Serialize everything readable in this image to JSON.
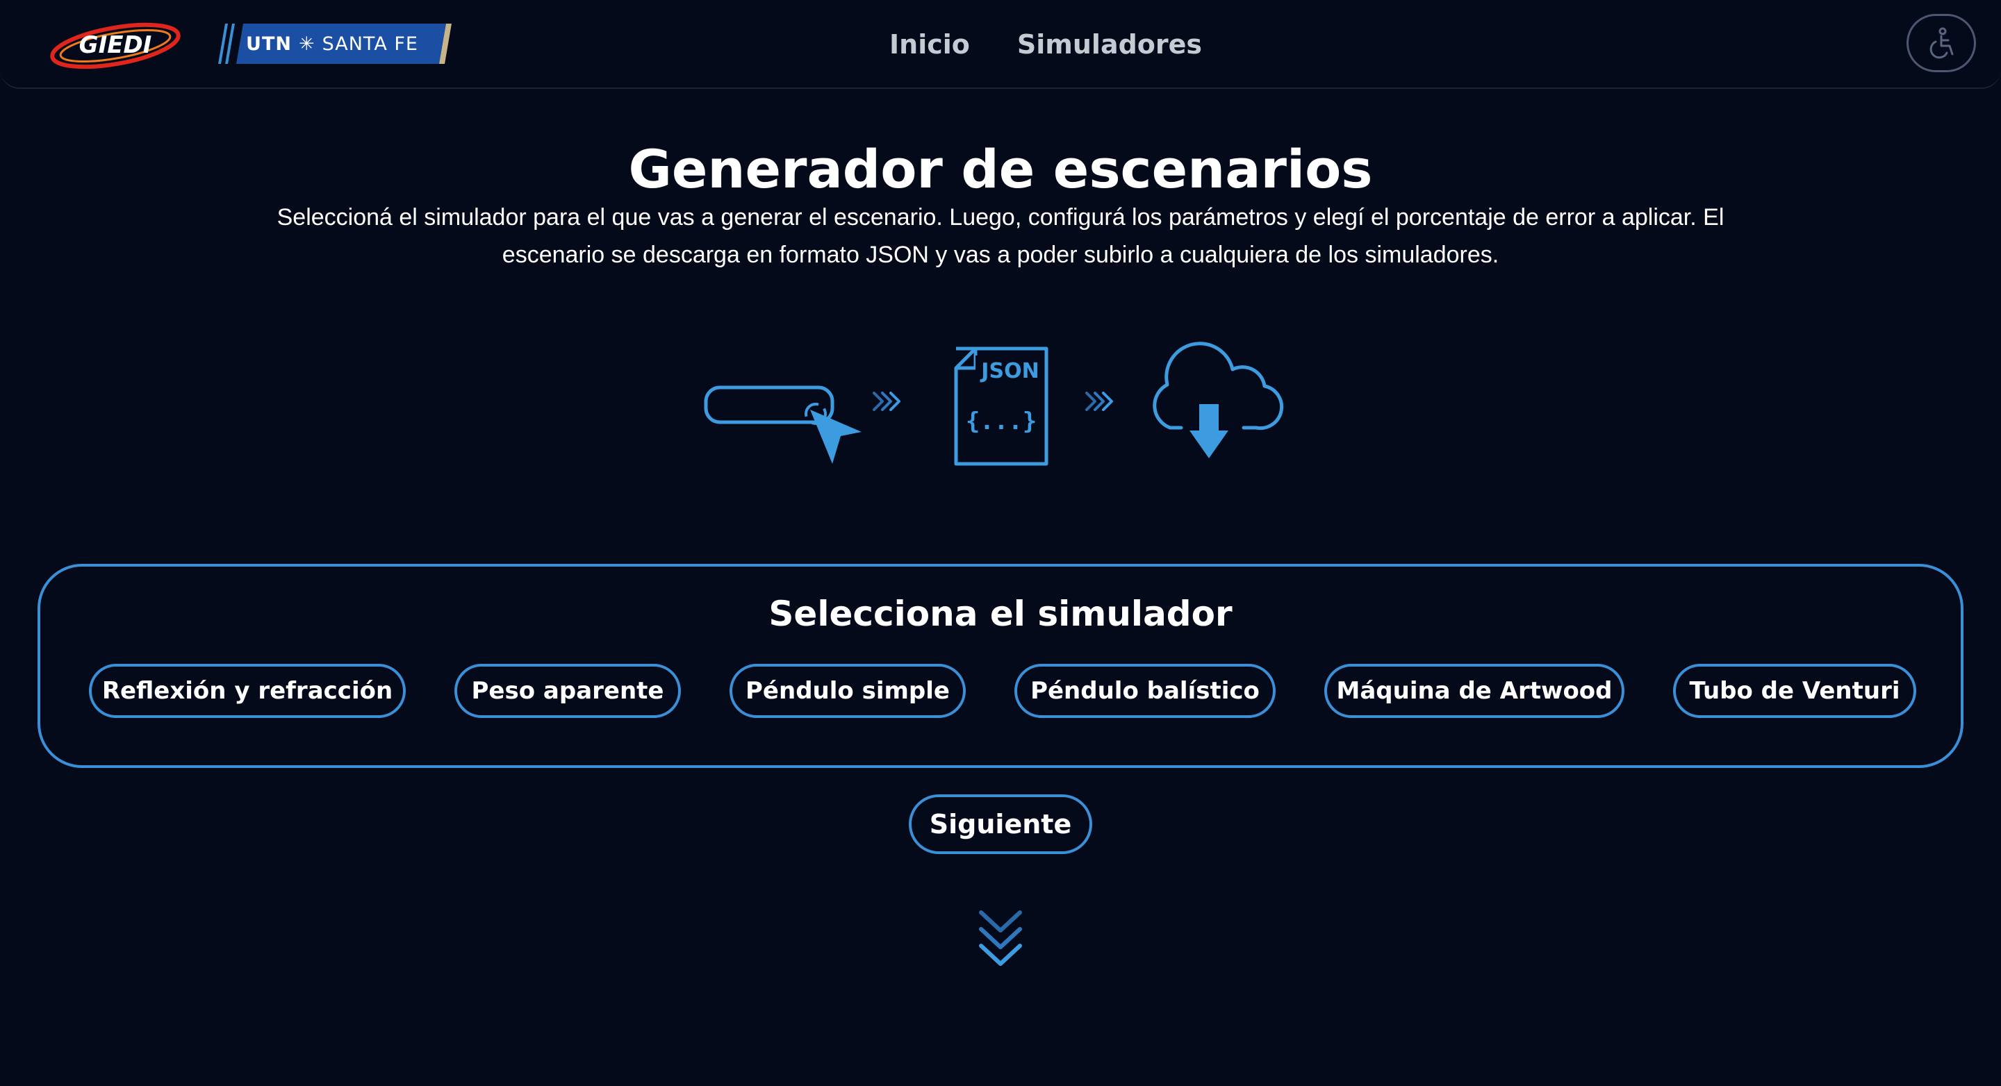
{
  "header": {
    "logo_giedi_text": "GIEDI",
    "logo_utn_name": "UTN",
    "logo_utn_place": "SANTA FE",
    "nav": [
      {
        "label": "Inicio"
      },
      {
        "label": "Simuladores"
      }
    ],
    "accessibility_icon": "wheelchair-icon"
  },
  "hero": {
    "title": "Generador de escenarios",
    "description_line1": "Seleccioná el simulador para el que vas a generar el escenario. Luego, configurá los parámetros y elegí el porcentaje de error a aplicar. El",
    "description_line2": "escenario se descarga en formato JSON y vas a poder subirlo a cualquiera de los simuladores."
  },
  "process": {
    "step1_icon": "select-input-cursor-icon",
    "arrow_icon": "triple-chevron-right-icon",
    "step2_label": "JSON",
    "step2_body": "{...}",
    "step3_icon": "cloud-download-icon"
  },
  "selector": {
    "title": "Selecciona el simulador",
    "options": [
      {
        "label": "Reflexión y refracción"
      },
      {
        "label": "Peso aparente"
      },
      {
        "label": "Péndulo simple"
      },
      {
        "label": "Péndulo balístico"
      },
      {
        "label": "Máquina de Artwood"
      },
      {
        "label": "Tubo de Venturi"
      }
    ]
  },
  "actions": {
    "next_label": "Siguiente",
    "scroll_icon": "chevrons-down-icon"
  },
  "colors": {
    "background": "#050a1a",
    "accent": "#3a8fd6",
    "icon_blue": "#3d9be0",
    "nav_text": "#c6cad3"
  }
}
